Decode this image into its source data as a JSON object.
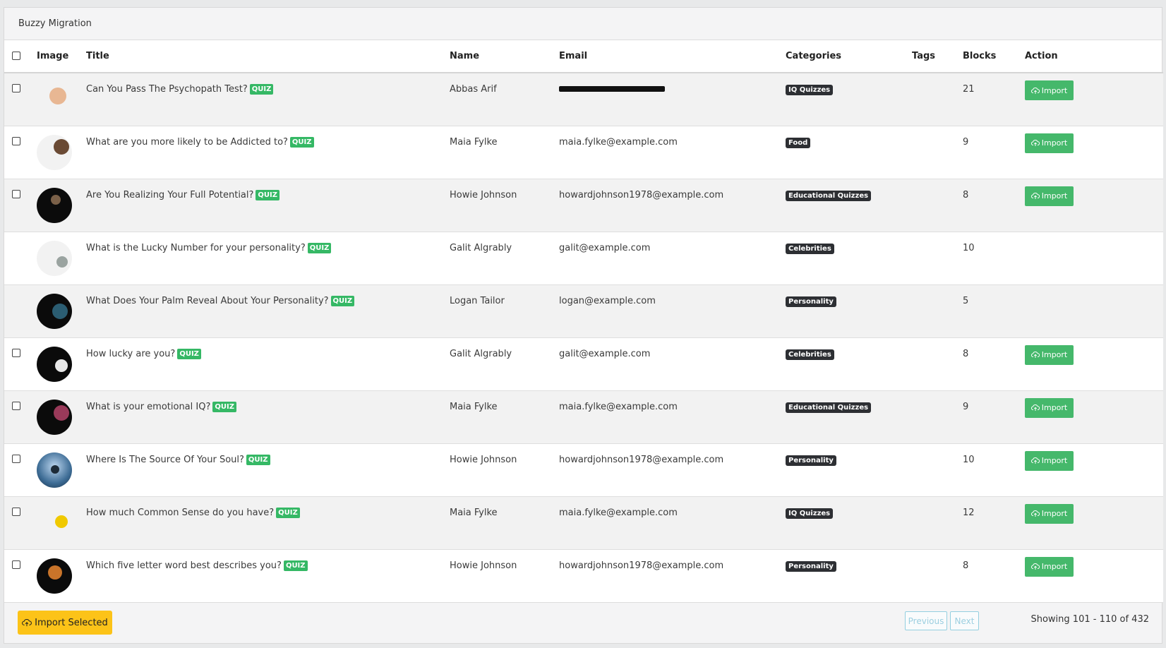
{
  "panel": {
    "title": "Buzzy Migration"
  },
  "table": {
    "columns": {
      "image": "Image",
      "title": "Title",
      "name": "Name",
      "email": "Email",
      "categories": "Categories",
      "tags": "Tags",
      "blocks": "Blocks",
      "action": "Action"
    },
    "quiz_badge": "QUIZ",
    "import_label": "Import",
    "rows": [
      {
        "title": "Can You Pass The Psychopath Test?",
        "name": "Abbas Arif",
        "email": "",
        "email_redacted": true,
        "category": "IQ Quizzes",
        "tags": "",
        "blocks": "21",
        "selectable": true,
        "importable": true,
        "thumb_icon": "man-face-image"
      },
      {
        "title": "What are you more likely to be Addicted to?",
        "name": "Maia Fylke",
        "email": "maia.fylke@example.com",
        "category": "Food",
        "tags": "",
        "blocks": "9",
        "selectable": true,
        "importable": true,
        "thumb_icon": "woman-portrait-image"
      },
      {
        "title": "Are You Realizing Your Full Potential?",
        "name": "Howie Johnson",
        "email": "howardjohnson1978@example.com",
        "category": "Educational Quizzes",
        "tags": "",
        "blocks": "8",
        "selectable": true,
        "importable": true,
        "thumb_icon": "dark-portrait-image"
      },
      {
        "title": "What is the Lucky Number for your personality?",
        "name": "Galit Algrably",
        "email": "galit@example.com",
        "category": "Celebrities",
        "tags": "",
        "blocks": "10",
        "selectable": false,
        "importable": false,
        "thumb_icon": "lucky-number-image"
      },
      {
        "title": "What Does Your Palm Reveal About Your Personality?",
        "name": "Logan Tailor",
        "email": "logan@example.com",
        "category": "Personality",
        "tags": "",
        "blocks": "5",
        "selectable": false,
        "importable": false,
        "thumb_icon": "palm-image"
      },
      {
        "title": "How lucky are you?",
        "name": "Galit Algrably",
        "email": "galit@example.com",
        "category": "Celebrities",
        "tags": "",
        "blocks": "8",
        "selectable": true,
        "importable": true,
        "thumb_icon": "lucky-image"
      },
      {
        "title": "What is your emotional IQ?",
        "name": "Maia Fylke",
        "email": "maia.fylke@example.com",
        "category": "Educational Quizzes",
        "tags": "",
        "blocks": "9",
        "selectable": true,
        "importable": true,
        "thumb_icon": "brain-image"
      },
      {
        "title": "Where Is The Source Of Your Soul?",
        "name": "Howie Johnson",
        "email": "howardjohnson1978@example.com",
        "category": "Personality",
        "tags": "",
        "blocks": "10",
        "selectable": true,
        "importable": true,
        "thumb_icon": "meditation-image"
      },
      {
        "title": "How much Common Sense do you have?",
        "name": "Maia Fylke",
        "email": "maia.fylke@example.com",
        "category": "IQ Quizzes",
        "tags": "",
        "blocks": "12",
        "selectable": true,
        "importable": true,
        "thumb_icon": "minion-image"
      },
      {
        "title": "Which five letter word best describes you?",
        "name": "Howie Johnson",
        "email": "howardjohnson1978@example.com",
        "category": "Personality",
        "tags": "",
        "blocks": "8",
        "selectable": true,
        "importable": true,
        "thumb_icon": "number-five-image"
      }
    ]
  },
  "footer": {
    "import_selected": "Import Selected",
    "previous": "Previous",
    "next": "Next",
    "showing": "Showing 101 - 110 of 432"
  },
  "colors": {
    "import_green": "#45b86b",
    "quiz_green": "#35b865",
    "category_dark": "#2d2f33",
    "import_selected_yellow": "#fcc318",
    "pager_border": "#94cfe0"
  }
}
